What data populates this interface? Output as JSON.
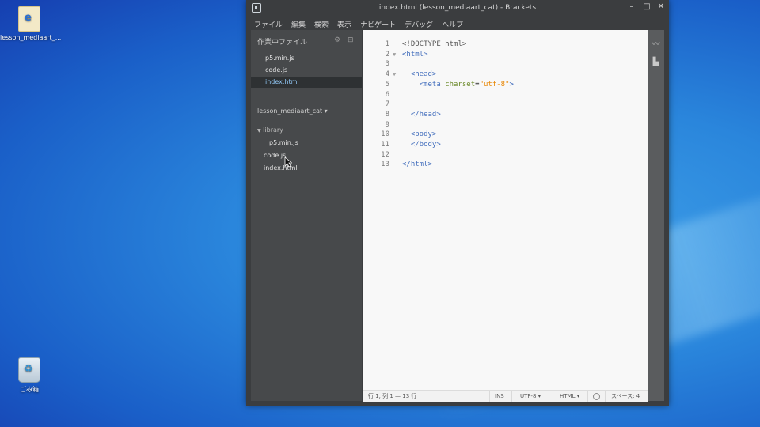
{
  "desktop": {
    "icons": [
      {
        "label": "lesson_mediaart_...",
        "icon": "folder-icon"
      },
      {
        "label": "ごみ箱",
        "icon": "recycle-bin-icon"
      }
    ]
  },
  "window": {
    "title": "index.html (lesson_mediaart_cat) - Brackets",
    "controls": {
      "minimize": "–",
      "maximize": "□",
      "close": "✕"
    }
  },
  "menu": [
    "ファイル",
    "編集",
    "検索",
    "表示",
    "ナビゲート",
    "デバッグ",
    "ヘルプ"
  ],
  "sidebar": {
    "working_files_title": "作業中ファイル",
    "working_files": [
      {
        "name": "p5.min.js"
      },
      {
        "name": "code.js"
      },
      {
        "name": "index.html",
        "active": true
      }
    ],
    "project_name": "lesson_mediaart_cat ▾",
    "tree": [
      {
        "name": "library",
        "type": "folder",
        "depth": 0
      },
      {
        "name": "p5.min.js",
        "type": "file",
        "depth": 1
      },
      {
        "name": "code.js",
        "type": "file",
        "depth": 0
      },
      {
        "name": "index.html",
        "type": "file",
        "depth": 0
      }
    ]
  },
  "editor": {
    "lines": [
      {
        "n": "1",
        "fold": "",
        "text": "<!DOCTYPE html>"
      },
      {
        "n": "2",
        "fold": "▼",
        "text": "<html>"
      },
      {
        "n": "3",
        "fold": "",
        "text": ""
      },
      {
        "n": "4",
        "fold": "▼",
        "text": "  <head>"
      },
      {
        "n": "5",
        "fold": "",
        "text": "    <meta charset=\"utf-8\">"
      },
      {
        "n": "6",
        "fold": "",
        "text": ""
      },
      {
        "n": "7",
        "fold": "",
        "text": ""
      },
      {
        "n": "8",
        "fold": "",
        "text": "  </head>"
      },
      {
        "n": "9",
        "fold": "",
        "text": ""
      },
      {
        "n": "10",
        "fold": "",
        "text": "  <body>"
      },
      {
        "n": "11",
        "fold": "",
        "text": "  </body>"
      },
      {
        "n": "12",
        "fold": "",
        "text": ""
      },
      {
        "n": "13",
        "fold": "",
        "text": "</html>"
      }
    ]
  },
  "status": {
    "position": "行 1, 列 1 — 13 行",
    "mode": "INS",
    "encoding": "UTF-8 ▾",
    "language": "HTML ▾",
    "spaces": "スペース: 4"
  },
  "colors": {
    "tag": "#446fbd",
    "attr": "#6c8a2a",
    "string": "#e88501",
    "active_file": "#8ec3f0"
  }
}
